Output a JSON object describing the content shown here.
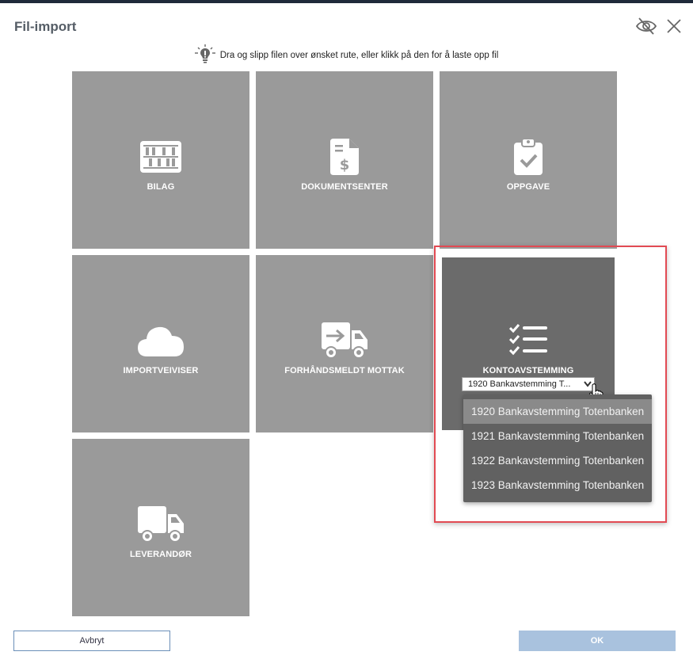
{
  "dialog": {
    "title": "Fil-import",
    "hint": "Dra og slipp filen over ønsket rute, eller klikk på den for å laste opp fil"
  },
  "tiles": [
    {
      "label": "BILAG",
      "icon": "abacus-icon"
    },
    {
      "label": "DOKUMENTSENTER",
      "icon": "document-dollar-icon"
    },
    {
      "label": "OPPGAVE",
      "icon": "clipboard-check-icon"
    },
    {
      "label": "IMPORTVEIVISER",
      "icon": "cloud-icon"
    },
    {
      "label": "FORHÅNDSMELDT MOTTAK",
      "icon": "truck-arrow-icon"
    },
    {
      "label": "KONTOAVSTEMMING",
      "icon": "checklist-icon"
    },
    {
      "label": "LEVERANDØR",
      "icon": "truck-icon"
    }
  ],
  "account_select": {
    "selected": "1920 Bankavstemming T...",
    "options": [
      "1920 Bankavstemming Totenbanken",
      "1921 Bankavstemming Totenbanken",
      "1922 Bankavstemming Totenbanken",
      "1923 Bankavstemming Totenbanken"
    ]
  },
  "buttons": {
    "cancel": "Avbryt",
    "ok": "OK"
  },
  "colors": {
    "tile": "#9a9a9a",
    "tile_active": "#6b6b6b",
    "highlight": "#e24a53",
    "ok_button": "#a9c2de"
  }
}
